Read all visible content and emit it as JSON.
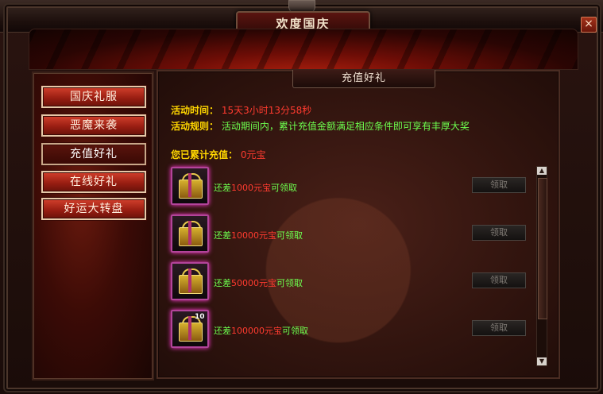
{
  "window": {
    "title": "欢度国庆",
    "close_icon": "close-icon"
  },
  "sidebar": {
    "items": [
      {
        "label": "国庆礼服",
        "active": false
      },
      {
        "label": "恶魔来袭",
        "active": false
      },
      {
        "label": "充值好礼",
        "active": true
      },
      {
        "label": "在线好礼",
        "active": false
      },
      {
        "label": "好运大转盘",
        "active": false
      }
    ]
  },
  "main": {
    "section_title": "充值好礼",
    "time_label": "活动时间：",
    "time_value": "15天3小时13分58秒",
    "rule_label": "活动规则：",
    "rule_value": "活动期间内，累计充值金额满足相应条件即可享有丰厚大奖",
    "total_label": "您已累计充值：",
    "total_value": "0元宝",
    "rewards": [
      {
        "prefix": "还差",
        "amount": "1000元宝",
        "suffix": "可领取",
        "button": "领取",
        "badge": ""
      },
      {
        "prefix": "还差",
        "amount": "10000元宝",
        "suffix": "可领取",
        "button": "领取",
        "badge": ""
      },
      {
        "prefix": "还差",
        "amount": "50000元宝",
        "suffix": "可领取",
        "button": "领取",
        "badge": ""
      },
      {
        "prefix": "还差",
        "amount": "100000元宝",
        "suffix": "可领取",
        "button": "领取",
        "badge": "10"
      }
    ]
  },
  "scrollbar": {
    "up_icon": "▲",
    "down_icon": "▼"
  }
}
